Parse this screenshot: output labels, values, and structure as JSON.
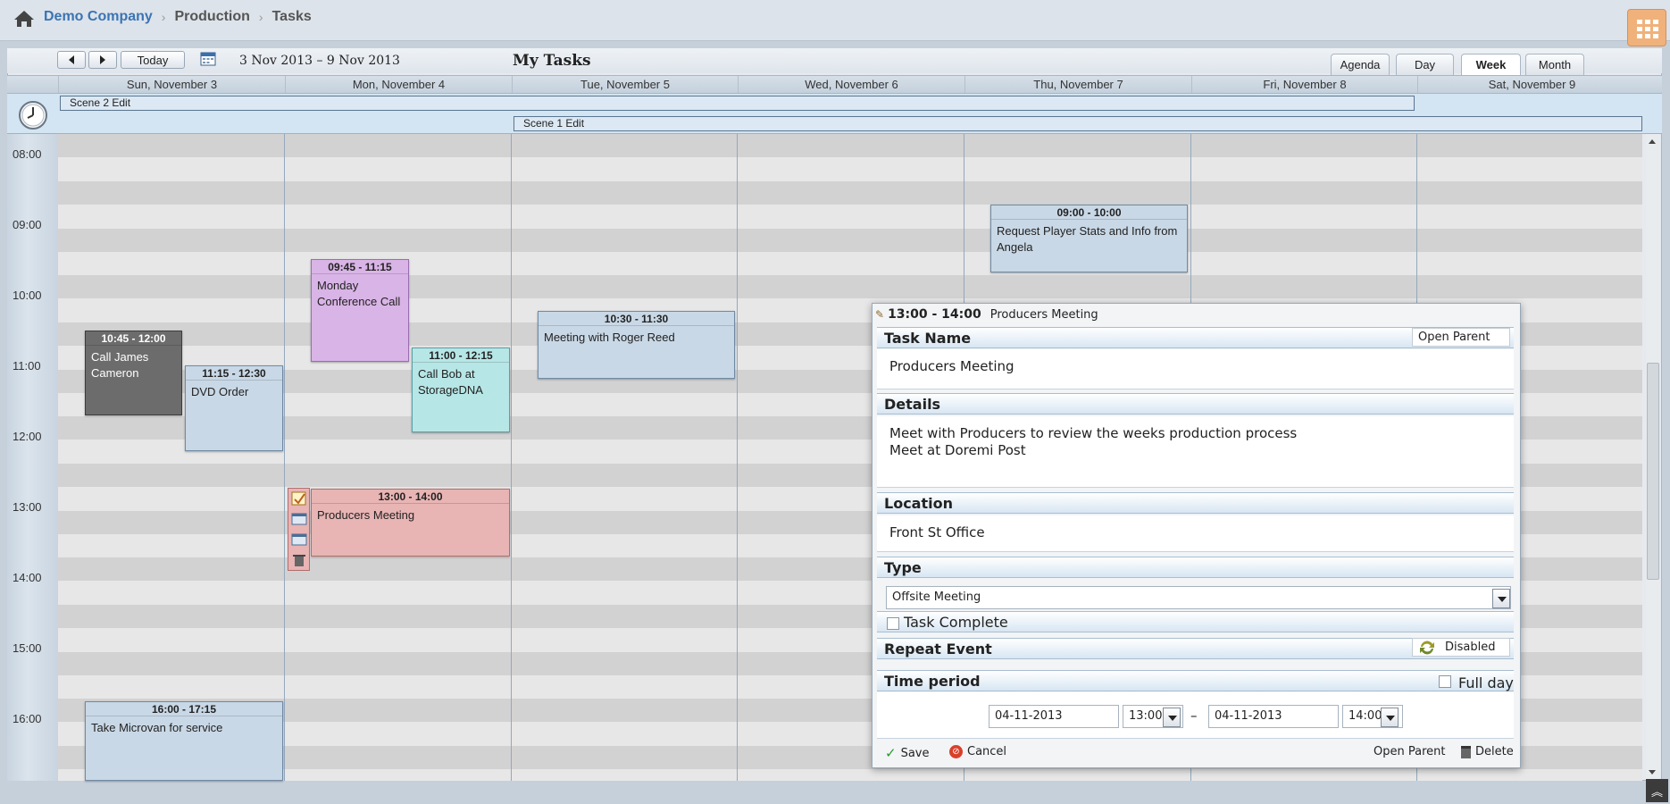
{
  "breadcrumb": [
    "Demo Company",
    "Production",
    "Tasks"
  ],
  "toolbar": {
    "today": "Today",
    "date_range": "3 Nov 2013 – 9 Nov 2013",
    "title": "My Tasks"
  },
  "views": [
    "Agenda",
    "Day",
    "Week",
    "Month"
  ],
  "active_view": "Week",
  "days": [
    "Sun, November 3",
    "Mon, November 4",
    "Tue, November 5",
    "Wed, November 6",
    "Thu, November 7",
    "Fri, November 8",
    "Sat, November 9"
  ],
  "allday_events": [
    "Scene 2 Edit",
    "Scene 1 Edit"
  ],
  "hours": [
    "08:00",
    "09:00",
    "10:00",
    "11:00",
    "12:00",
    "13:00",
    "14:00",
    "15:00",
    "16:00"
  ],
  "events": [
    {
      "time": "10:45 - 12:00",
      "text": "Call James Cameron",
      "color": "#6c6c6c"
    },
    {
      "time": "11:15 - 12:30",
      "text": "DVD Order",
      "color": "#c9d8e6"
    },
    {
      "time": "09:45 - 11:15",
      "text": "Monday Conference Call",
      "color": "#d9b4e6"
    },
    {
      "time": "11:00 - 12:15",
      "text": "Call Bob at StorageDNA",
      "color": "#b7e6e6"
    },
    {
      "time": "13:00 - 14:00",
      "text": "Producers Meeting",
      "color": "#e8b4b4"
    },
    {
      "time": "10:30 - 11:30",
      "text": "Meeting with Roger Reed",
      "color": "#c9d8e6"
    },
    {
      "time": "09:00 - 10:00",
      "text": "Request Player Stats and Info from Angela",
      "color": "#c9d8e6"
    },
    {
      "time": "16:00 - 17:15",
      "text": "Take Microvan for service",
      "color": "#c9d8e6"
    }
  ],
  "lightbox": {
    "header_time": "13:00 - 14:00",
    "header_title": "Producers Meeting",
    "task_name_label": "Task Name",
    "open_parent": "Open Parent",
    "task_name": "Producers Meeting",
    "details_label": "Details",
    "details_line1": "Meet with Producers to review the weeks production process",
    "details_line2": "Meet at Doremi Post",
    "location_label": "Location",
    "location": "Front St Office",
    "type_label": "Type",
    "type_value": "Offsite Meeting",
    "task_complete": "Task Complete",
    "repeat_label": "Repeat Event",
    "repeat_value": "Disabled",
    "time_period_label": "Time period",
    "full_day": "Full day",
    "start_date": "04-11-2013",
    "start_time": "13:00",
    "dash": "–",
    "end_date": "04-11-2013",
    "end_time": "14:00",
    "save": "Save",
    "cancel": "Cancel",
    "open_parent_footer": "Open Parent",
    "delete": "Delete"
  }
}
